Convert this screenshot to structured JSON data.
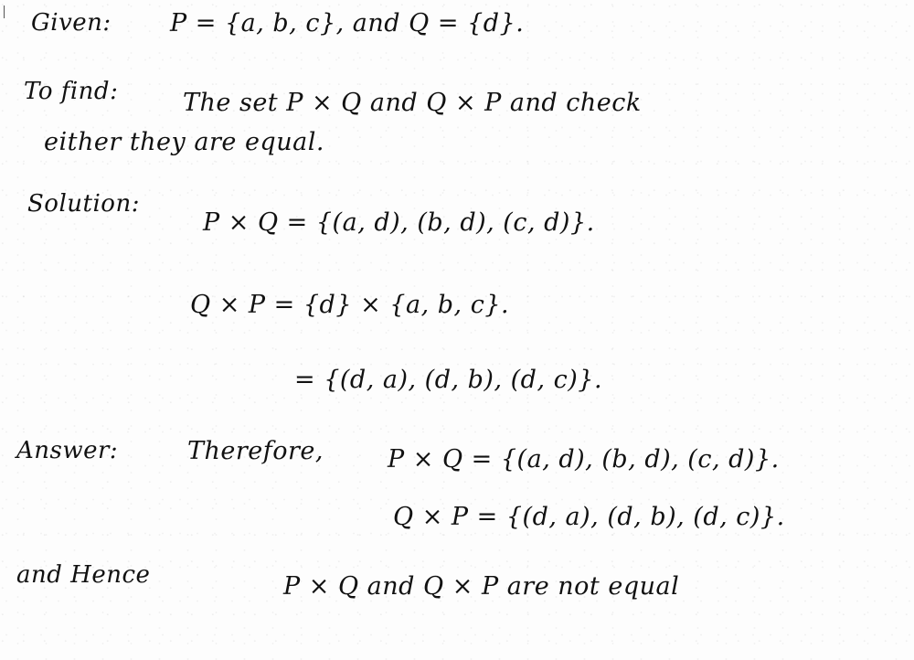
{
  "given": {
    "label": "Given:",
    "text": "P = {a, b, c}, and Q = {d}."
  },
  "to_find": {
    "label": "To find:",
    "line1": "The set P × Q and Q × P and check",
    "line2": "either they are equal."
  },
  "solution": {
    "label": "Solution:",
    "pxq": "P × Q = {(a, d), (b, d), (c, d)}.",
    "qxp_step1": "Q × P = {d} × {a, b, c}.",
    "qxp_step2": "= {(d, a), (d, b), (d, c)}."
  },
  "answer": {
    "label": "Answer:",
    "intro": "Therefore,",
    "pxq": "P × Q = {(a, d), (b, d), (c, d)}.",
    "qxp": "Q × P = {(d, a), (d, b), (d, c)}."
  },
  "conclusion": {
    "label": "and Hence",
    "text": "P × Q and Q × P are not equal"
  }
}
